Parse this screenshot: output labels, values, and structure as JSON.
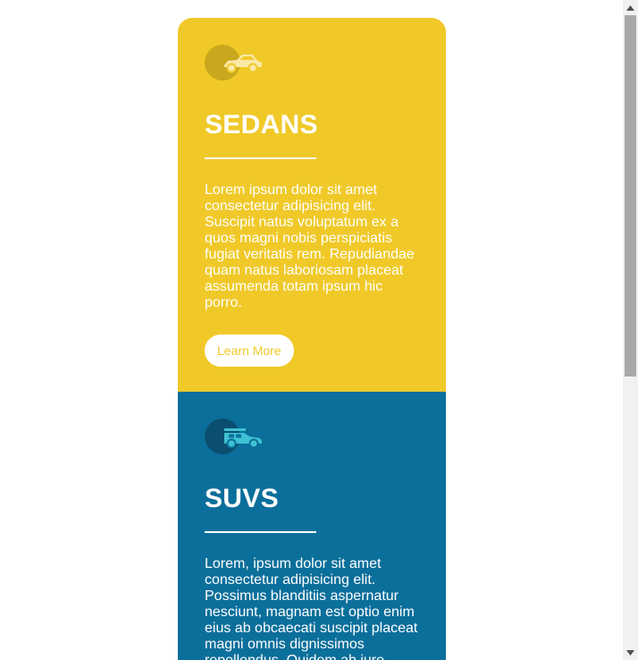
{
  "cards": [
    {
      "title": "SEDANS",
      "text": "Lorem ipsum dolor sit amet consectetur adipisicing elit. Suscipit natus voluptatum ex a quos magni nobis perspiciatis fugiat veritatis rem. Repudiandae quam natus laboriosam placeat assumenda totam ipsum hic porro.",
      "button": "Learn More",
      "icon": "sedan-car-icon",
      "color": "#f0c929"
    },
    {
      "title": "SUVS",
      "text": "Lorem, ipsum dolor sit amet consectetur adipisicing elit. Possimus blanditiis aspernatur nesciunt, magnam est optio enim eius ab obcaecati suscipit placeat magni omnis dignissimos repellendus. Quidem ab iure.",
      "icon": "suv-car-icon",
      "color": "#0b6f9b"
    }
  ]
}
